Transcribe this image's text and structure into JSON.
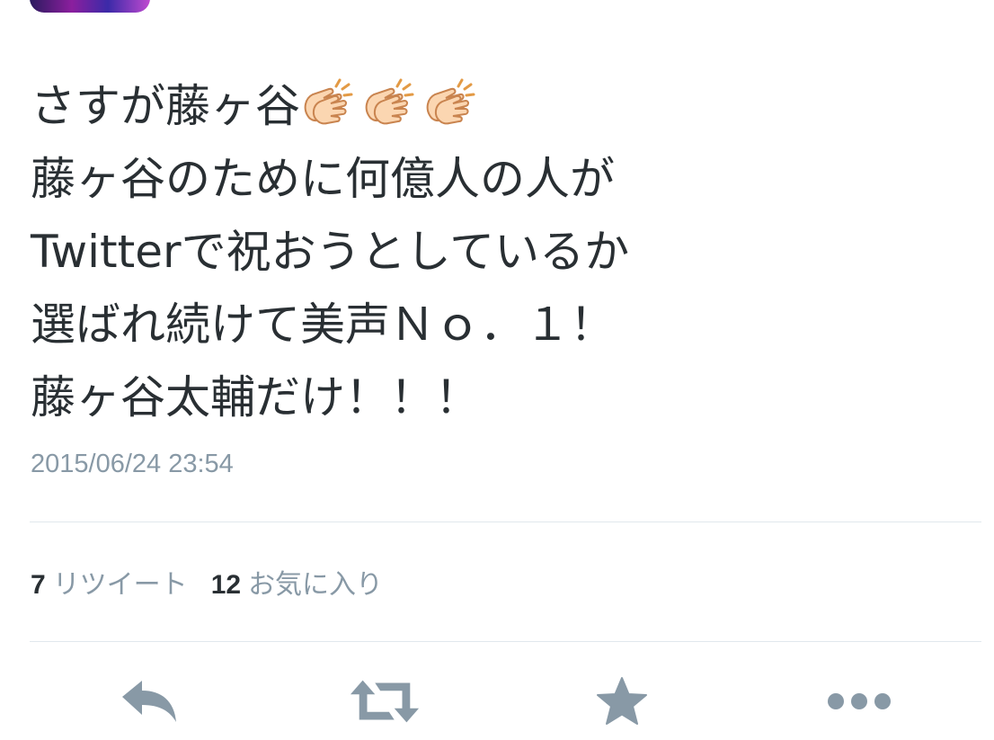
{
  "tweet": {
    "lines": [
      "さすが藤ヶ谷",
      "藤ヶ谷のために何億人の人が",
      "Twitterで祝おうとしているか",
      "選ばれ続けて美声Ｎｏ．１！",
      "藤ヶ谷太輔だけ！！！"
    ],
    "emoji": [
      "clapping-hands",
      "clapping-hands",
      "clapping-hands"
    ],
    "timestamp": "2015/06/24 23:54"
  },
  "stats": {
    "retweet_count": "7",
    "retweet_label": "リツイート",
    "favorite_count": "12",
    "favorite_label": "お気に入り"
  },
  "actions": {
    "icons": [
      "reply-icon",
      "retweet-icon",
      "star-icon",
      "more-icon"
    ],
    "icon_color": "#8899a6"
  },
  "colors": {
    "text": "#292f33",
    "muted": "#8899a6",
    "divider": "#e1e8ed"
  }
}
